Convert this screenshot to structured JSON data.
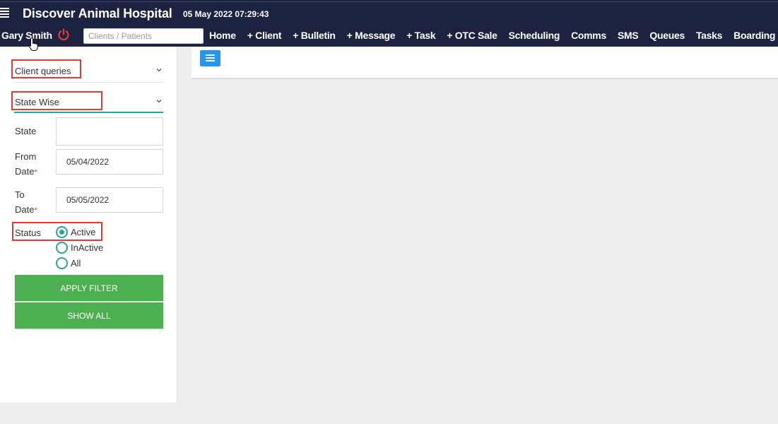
{
  "header": {
    "title": "Discover Animal Hospital",
    "datetime": "05 May 2022 07:29:43",
    "user": "Gary Smith",
    "search_placeholder": "Clients / Patients",
    "nav": [
      "Home",
      "+ Client",
      "+ Bulletin",
      "+ Message",
      "+ Task",
      "+ OTC Sale",
      "Scheduling",
      "Comms",
      "SMS",
      "Queues",
      "Tasks",
      "Boarding"
    ]
  },
  "sidebar": {
    "accordion1": "Client queries",
    "accordion2": "State Wise",
    "state_label": "State",
    "state_value": "",
    "from_label_1": "From",
    "from_label_2": "Date",
    "from_value": "05/04/2022",
    "to_label_1": "To",
    "to_label_2": "Date",
    "to_value": "05/05/2022",
    "required_mark": "*",
    "status_label": "Status",
    "status_options": [
      "Active",
      "InActive",
      "All"
    ],
    "status_selected": "Active",
    "apply_label": "APPLY FILTER",
    "show_all_label": "SHOW ALL"
  },
  "colors": {
    "header_bg": "#1c2340",
    "accent": "#26a69a",
    "button_green": "#4caf50",
    "highlight": "#e53935",
    "menu_blue": "#2196f3",
    "power_red": "#e53935"
  }
}
